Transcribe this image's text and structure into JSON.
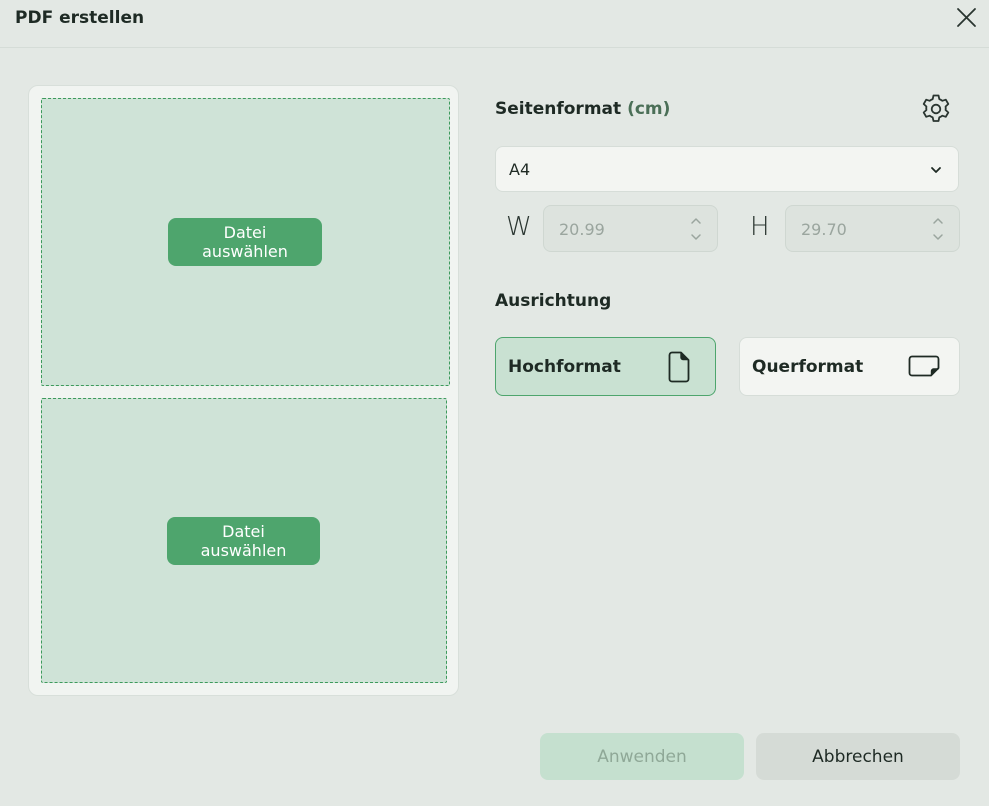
{
  "dialog": {
    "title": "PDF erstellen",
    "close_icon": "close-icon"
  },
  "preview": {
    "zones": [
      {
        "button_label": "Datei auswählen"
      },
      {
        "button_label": "Datei auswählen"
      }
    ]
  },
  "page_format": {
    "label": "Seitenformat",
    "unit": "(cm)",
    "settings_icon": "gear-icon",
    "selected": "A4",
    "width_letter": "W",
    "height_letter": "H",
    "width_value": "20.99",
    "height_value": "29.70"
  },
  "orientation": {
    "label": "Ausrichtung",
    "options": [
      {
        "label": "Hochformat",
        "icon": "portrait-page-icon",
        "selected": true
      },
      {
        "label": "Querformat",
        "icon": "landscape-page-icon",
        "selected": false
      }
    ]
  },
  "footer": {
    "apply_label": "Anwenden",
    "cancel_label": "Abbrechen"
  },
  "colors": {
    "accent": "#4ea56d",
    "drop_zone_bg": "#cfe3d7",
    "background": "#e3e8e4"
  }
}
